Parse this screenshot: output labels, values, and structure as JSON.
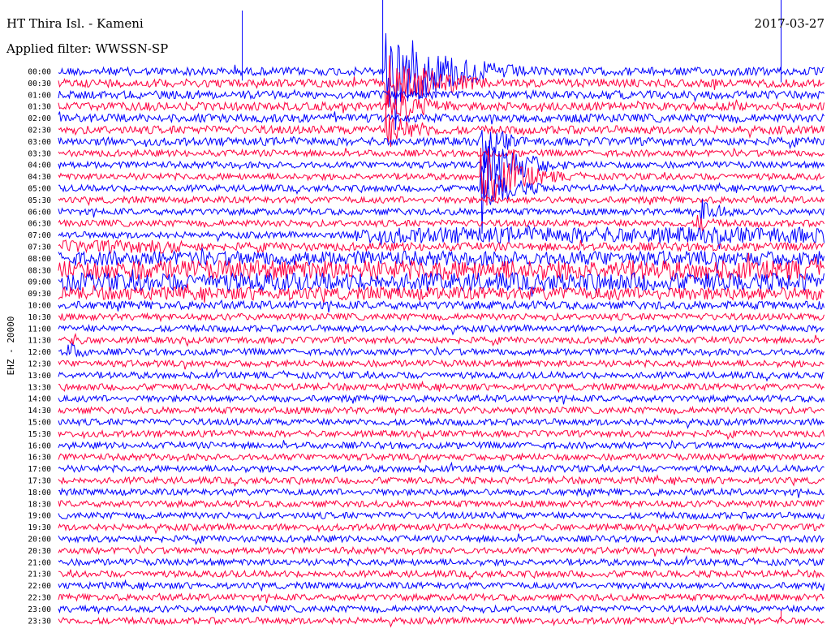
{
  "header": {
    "station": "HT Thira Isl. - Kameni",
    "filter": "Applied filter: WWSSN-SP",
    "date": "2017-03-27"
  },
  "chart_data": {
    "type": "line",
    "title": "HT Thira Isl. - Kameni",
    "subtitle": "Applied filter: WWSSN-SP",
    "ylabel": "EHZ - 20000",
    "date": "2017-03-27",
    "row_labels": [
      "00:00",
      "00:30",
      "01:00",
      "01:30",
      "02:00",
      "02:30",
      "03:00",
      "03:30",
      "04:00",
      "04:30",
      "05:00",
      "05:30",
      "06:00",
      "06:30",
      "07:00",
      "07:30",
      "08:00",
      "08:30",
      "09:00",
      "09:30",
      "10:00",
      "10:30",
      "11:00",
      "11:30",
      "12:00",
      "12:30",
      "13:00",
      "13:30",
      "14:00",
      "14:30",
      "15:00",
      "15:30",
      "16:00",
      "16:30",
      "17:00",
      "17:30",
      "18:00",
      "18:30",
      "19:00",
      "19:30",
      "20:00",
      "20:30",
      "21:00",
      "21:30",
      "22:00",
      "22:30",
      "23:00",
      "23:30"
    ],
    "trace_colors": [
      "#0000ff",
      "#ff0040"
    ],
    "trace_minutes": 30,
    "base_amplitude": 4,
    "amplitude_by_row": [
      5,
      5,
      5,
      5,
      5,
      5,
      5,
      4,
      4,
      4,
      4,
      4,
      4,
      4,
      4,
      5,
      6,
      7,
      7,
      6,
      5,
      4,
      4,
      4,
      4,
      4,
      4,
      4,
      4,
      4,
      4,
      4,
      4,
      4,
      4,
      4,
      4,
      4,
      4,
      4,
      4,
      4,
      4,
      4,
      4,
      4,
      4,
      4
    ],
    "noisy_segments": [
      {
        "row": 14,
        "from_min": 11.5,
        "to_min": 30,
        "amp": 10
      },
      {
        "row": 15,
        "from_min": 0,
        "to_min": 5,
        "amp": 8
      },
      {
        "row": 16,
        "from_min": 0,
        "to_min": 30,
        "amp": 9
      },
      {
        "row": 17,
        "from_min": 0,
        "to_min": 30,
        "amp": 12
      },
      {
        "row": 18,
        "from_min": 0,
        "to_min": 30,
        "amp": 11
      },
      {
        "row": 19,
        "from_min": 0,
        "to_min": 30,
        "amp": 8
      }
    ],
    "events": [
      {
        "row": 0,
        "minute": 12.8,
        "amp": 60,
        "decay_min": 2.5
      },
      {
        "row": 1,
        "minute": 12.8,
        "amp": 38,
        "decay_min": 2.2
      },
      {
        "row": 3,
        "minute": 12.8,
        "amp": 26,
        "decay_min": 1.8
      },
      {
        "row": 5,
        "minute": 12.8,
        "amp": 24,
        "decay_min": 1.6
      },
      {
        "row": 6,
        "minute": 16.5,
        "amp": 26,
        "decay_min": 1.2
      },
      {
        "row": 8,
        "minute": 16.5,
        "amp": 50,
        "decay_min": 1.5
      },
      {
        "row": 9,
        "minute": 16.5,
        "amp": 44,
        "decay_min": 1.6
      },
      {
        "row": 10,
        "minute": 16.5,
        "amp": 32,
        "decay_min": 1.4
      },
      {
        "row": 12,
        "minute": 25.0,
        "amp": 22,
        "decay_min": 1.0
      },
      {
        "row": 13,
        "minute": 25.0,
        "amp": 14,
        "decay_min": 0.8
      },
      {
        "row": 15,
        "minute": 2.5,
        "amp": 12,
        "decay_min": 1.0
      },
      {
        "row": 23,
        "minute": 0.3,
        "amp": 12,
        "decay_min": 0.8
      },
      {
        "row": 24,
        "minute": 0.3,
        "amp": 14,
        "decay_min": 0.8
      }
    ],
    "spikes": [
      {
        "row": 0,
        "minute": 7.2,
        "amp": 75
      },
      {
        "row": 0,
        "minute": 12.7,
        "amp": 88
      },
      {
        "row": 0,
        "minute": 28.3,
        "amp": 90
      },
      {
        "row": 47,
        "minute": 28.3,
        "amp": 12
      }
    ]
  }
}
